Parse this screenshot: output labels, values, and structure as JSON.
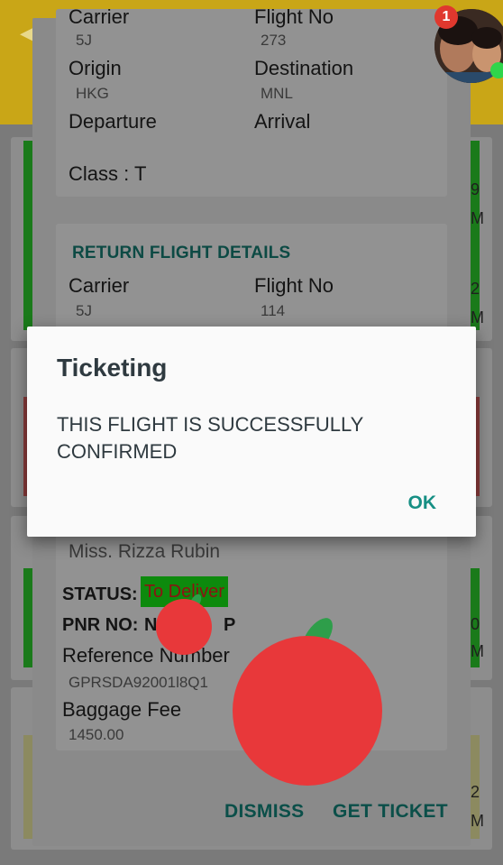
{
  "flight": {
    "carrier_label": "Carrier",
    "carrier_value": "5J",
    "flight_no_label": "Flight No",
    "flight_no_value": "273",
    "origin_label": "Origin",
    "origin_value": "HKG",
    "destination_label": "Destination",
    "destination_value": "MNL",
    "departure_label": "Departure",
    "arrival_label": "Arrival",
    "class_text": "Class : T"
  },
  "return_flight": {
    "title": "RETURN FLIGHT DETAILS",
    "carrier_label": "Carrier",
    "carrier_value": "5J",
    "flight_no_label": "Flight No",
    "flight_no_value": "114"
  },
  "passenger": {
    "name": "Miss. Rizza Rubin",
    "status_label": "STATUS:",
    "status_value": "To Deliver",
    "pnr_label": "PNR NO:",
    "pnr_value_visible": "N",
    "pnr_value_tail": "P",
    "reference_label": "Reference Number",
    "reference_value": "GPRSDA92001l8Q1",
    "baggage_label": "Baggage Fee",
    "baggage_value": "1450.00"
  },
  "sheet_actions": {
    "dismiss_label": "DISMISS",
    "get_ticket_label": "GET TICKET"
  },
  "dialog": {
    "title": "Ticketing",
    "message": "THIS FLIGHT IS SUCCESSFULLY CONFIRMED",
    "ok_label": "OK"
  },
  "chat_head": {
    "badge_count": "1"
  },
  "background": {
    "right_chars": [
      "9",
      "M",
      "2",
      "M",
      "0",
      "M",
      "2",
      "M"
    ]
  },
  "colors": {
    "app_bar": "#c9a617",
    "dialog_accent": "#168f84",
    "status_bg": "#0d8a0d",
    "apple_red": "#e8383a",
    "apple_leaf": "#2e9e4a"
  }
}
